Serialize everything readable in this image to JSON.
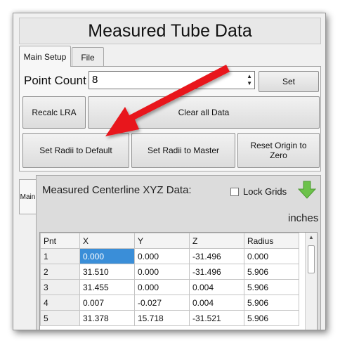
{
  "window": {
    "title": "Measured Tube Data"
  },
  "tabs": [
    {
      "label": "Main Setup"
    },
    {
      "label": "File"
    }
  ],
  "setup": {
    "point_count_label": "Point Count",
    "point_count_value": "8",
    "set_label": "Set",
    "recalc_label": "Recalc LRA",
    "clear_label": "Clear all Data",
    "radii_default_label": "Set Radii to Default",
    "radii_master_label": "Set Radii to Master",
    "reset_origin_label": "Reset Origin to Zero"
  },
  "data_panel": {
    "side_tab_label": "Main",
    "title": "Measured Centerline XYZ Data:",
    "lock_grids_label": "Lock Grids",
    "units": "inches"
  },
  "table": {
    "headers": [
      "Pnt",
      "X",
      "Y",
      "Z",
      "Radius"
    ],
    "rows": [
      [
        "1",
        "0.000",
        "0.000",
        "-31.496",
        "0.000"
      ],
      [
        "2",
        "31.510",
        "0.000",
        "-31.496",
        "5.906"
      ],
      [
        "3",
        "31.455",
        "0.000",
        "0.004",
        "5.906"
      ],
      [
        "4",
        "0.007",
        "-0.027",
        "0.004",
        "5.906"
      ],
      [
        "5",
        "31.378",
        "15.718",
        "-31.521",
        "5.906"
      ]
    ]
  },
  "colors": {
    "selection": "#3a8ed8",
    "annotation_arrow": "#e8191b",
    "down_arrow": "#6cc24a"
  },
  "icons": {
    "download": "green-down-arrow-icon",
    "annotation": "red-pointer-arrow"
  }
}
